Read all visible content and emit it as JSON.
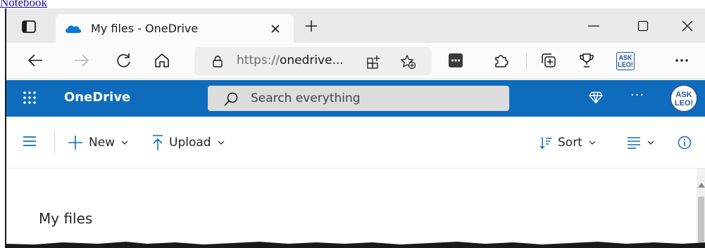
{
  "top_link": "Notebook",
  "browser": {
    "tab_title": "My files - OneDrive",
    "url_scheme": "https://",
    "url_host": "onedrive...",
    "extension_badge": [
      "ASK",
      "LEO!"
    ]
  },
  "onedrive": {
    "brand": "OneDrive",
    "search_placeholder": "Search everything",
    "more": "···",
    "avatar": [
      "ASK",
      "LEO!"
    ]
  },
  "commands": {
    "new": "New",
    "upload": "Upload",
    "sort": "Sort"
  },
  "page": {
    "title": "My files"
  },
  "colors": {
    "accent": "#0f6cbd",
    "tab_bar": "#e9e9e9",
    "onedrive_icon": "#0f78d4"
  }
}
